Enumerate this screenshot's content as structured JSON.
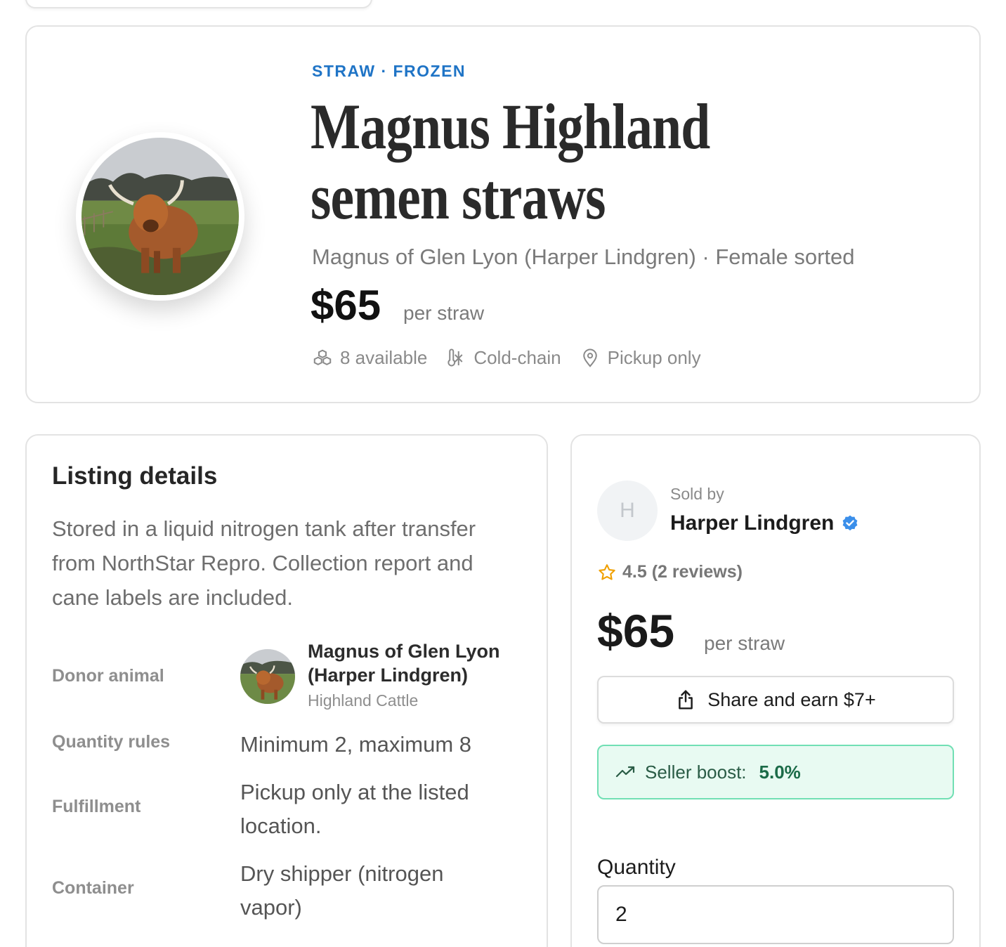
{
  "hero": {
    "category": "STRAW · FROZEN",
    "title_line1": "Magnus Highland",
    "title_line2": "semen straws",
    "subtitle": "Magnus of Glen Lyon (Harper Lindgren) · Female sorted",
    "price": "$65",
    "price_unit": "per straw",
    "meta": {
      "available": "8 available",
      "cold_chain": "Cold-chain",
      "pickup": "Pickup only"
    },
    "photo_alt": "Highland cattle"
  },
  "details": {
    "title": "Listing details",
    "description": "Stored in a liquid nitrogen tank after transfer from NorthStar Repro. Collection report and cane labels are included.",
    "rows": {
      "donor_label": "Donor animal",
      "donor_name": "Magnus of Glen Lyon (Harper Lindgren)",
      "donor_breed": "Highland Cattle",
      "quantity_label": "Quantity rules",
      "quantity_value": "Minimum 2, maximum 8",
      "fulfillment_label": "Fulfillment",
      "fulfillment_value": "Pickup only at the listed location.",
      "container_label": "Container",
      "container_value": "Dry shipper (nitrogen vapor)"
    }
  },
  "seller": {
    "avatar_initial": "H",
    "sold_by": "Sold by",
    "name": "Harper Lindgren",
    "rating": "4.5 (2 reviews)",
    "price": "$65",
    "price_unit": "per straw",
    "share_label": "Share and earn $7+",
    "boost_label": "Seller boost:",
    "boost_value": "5.0%",
    "quantity_label": "Quantity",
    "quantity_value": "2"
  },
  "colors": {
    "accent_blue": "#1f74c6",
    "boost_bg": "#e8faf2",
    "boost_border": "#71dfb4",
    "verified_blue": "#3b8fea",
    "star": "#f0a000"
  },
  "icons": {
    "available": "boxes-icon",
    "cold_chain": "snowflake-thermometer-icon",
    "pickup": "map-pin-icon",
    "verified": "verified-badge-icon",
    "rating": "star-icon",
    "share": "share-icon",
    "boost": "trending-up-icon"
  }
}
